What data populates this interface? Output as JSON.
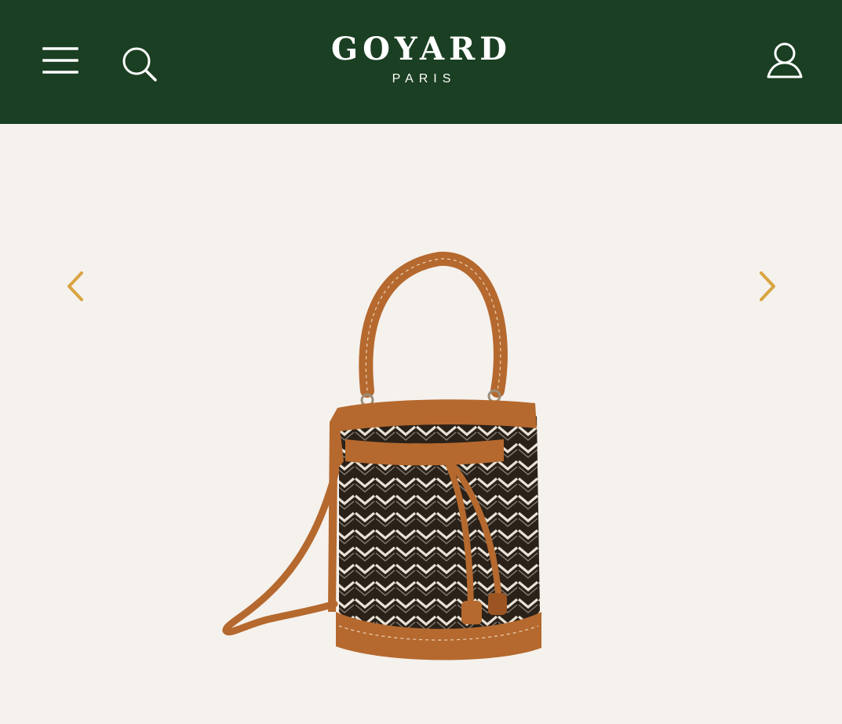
{
  "header": {
    "brand": "GOYARD",
    "brand_sub": "PARIS",
    "background_color": "#1a3f22",
    "icons": {
      "menu": "hamburger-menu-icon",
      "search": "search-icon",
      "account": "user-account-icon"
    }
  },
  "gallery": {
    "prev_icon": "chevron-left-icon",
    "next_icon": "chevron-right-icon",
    "arrow_color": "#d9a441",
    "background_color": "#f5f1ed",
    "product_colors": {
      "leather": "#b5692e",
      "canvas": "#2a2119",
      "pattern": "#e8e2d6"
    }
  }
}
